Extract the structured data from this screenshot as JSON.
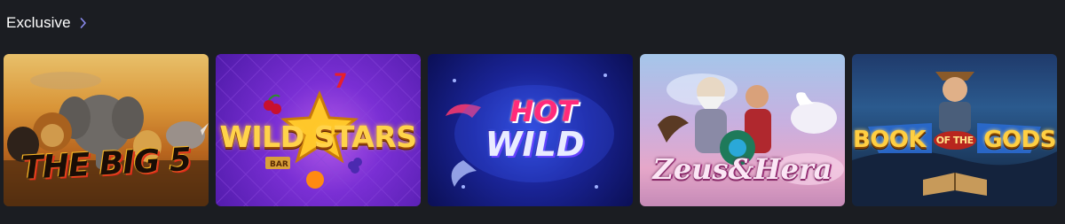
{
  "section": {
    "title": "Exclusive",
    "arrow_icon": "chevron-right-icon",
    "accent_color": "#8b8cf0"
  },
  "games": [
    {
      "logo": "THE BIG 5"
    },
    {
      "logo": "WILD STARS"
    },
    {
      "logo_top": "HOT",
      "logo_bottom": "WILD"
    },
    {
      "logo": "Zeus&Hera"
    },
    {
      "logo_left": "BOOK",
      "logo_mid": "OF THE",
      "logo_right": "GODS"
    }
  ]
}
